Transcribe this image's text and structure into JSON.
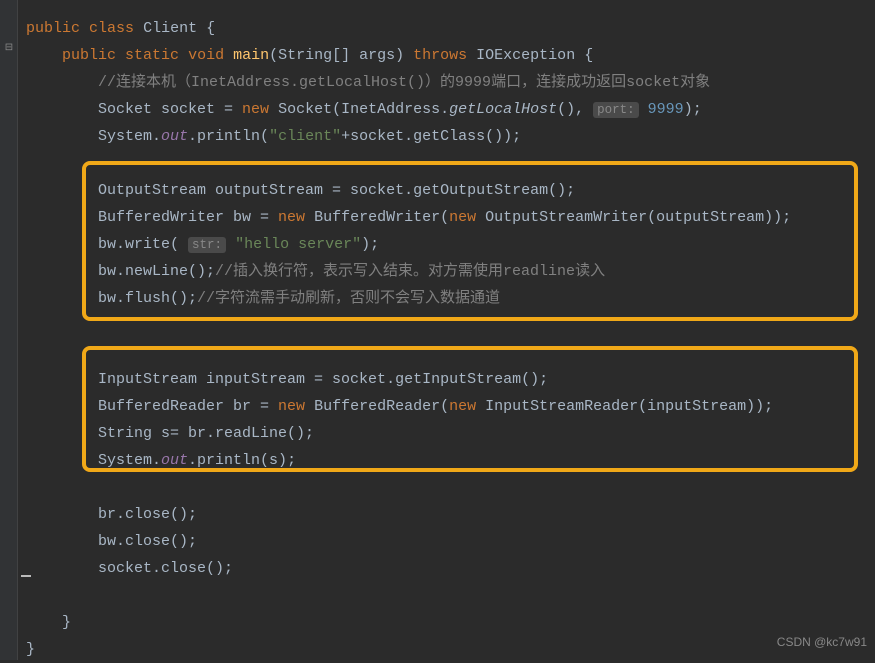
{
  "code": {
    "l1_public": "public",
    "l1_class": "class",
    "l1_name": "Client",
    "l1_brace": " {",
    "l2_indent": "    ",
    "l2_public": "public",
    "l2_static": "static",
    "l2_void": "void",
    "l2_main": "main",
    "l2_params": "(String[] args) ",
    "l2_throws": "throws",
    "l2_exc": " IOException {",
    "l3_indent": "        ",
    "l3_comment": "//连接本机（InetAddress.getLocalHost()）的9999端口，连接成功返回socket对象",
    "l4_indent": "        ",
    "l4_a": "Socket socket = ",
    "l4_new": "new",
    "l4_b": " Socket(InetAddress.",
    "l4_getlh": "getLocalHost",
    "l4_c": "(), ",
    "l4_hint": "port:",
    "l4_sp": " ",
    "l4_num": "9999",
    "l4_d": ");",
    "l5_indent": "        ",
    "l5_a": "System.",
    "l5_out": "out",
    "l5_b": ".println(",
    "l5_str": "\"client\"",
    "l5_c": "+socket.getClass());",
    "blank6": "",
    "l7_indent": "        ",
    "l7_a": "OutputStream outputStream = socket.getOutputStream();",
    "l8_indent": "        ",
    "l8_a": "BufferedWriter bw = ",
    "l8_new1": "new",
    "l8_b": " BufferedWriter(",
    "l8_new2": "new",
    "l8_c": " OutputStreamWriter(outputStream));",
    "l9_indent": "        ",
    "l9_a": "bw.write( ",
    "l9_hint": "str:",
    "l9_sp": " ",
    "l9_str": "\"hello server\"",
    "l9_b": ");",
    "l10_indent": "        ",
    "l10_a": "bw.newLine();",
    "l10_comment": "//插入换行符，表示写入结束。对方需使用readline读入",
    "l11_indent": "        ",
    "l11_a": "bw.flush();",
    "l11_comment": "//字符流需手动刷新，否则不会写入数据通道",
    "blank12": "",
    "blank13": "",
    "l14_indent": "        ",
    "l14_a": "InputStream inputStream = socket.getInputStream();",
    "l15_indent": "        ",
    "l15_a": "BufferedReader br = ",
    "l15_new1": "new",
    "l15_b": " BufferedReader(",
    "l15_new2": "new",
    "l15_c": " InputStreamReader(inputStream));",
    "l16_indent": "        ",
    "l16_a": "String s= br.readLine();",
    "l17_indent": "        ",
    "l17_a": "System.",
    "l17_out": "out",
    "l17_b": ".println(s);",
    "blank18": "",
    "l19_indent": "        ",
    "l19_a": "br.close();",
    "l20_indent": "        ",
    "l20_a": "bw.close();",
    "l21_indent": "        ",
    "l21_a": "socket.close();",
    "blank22": "",
    "l23": "    }",
    "l24": "}"
  },
  "watermark": "CSDN @kc7w91"
}
